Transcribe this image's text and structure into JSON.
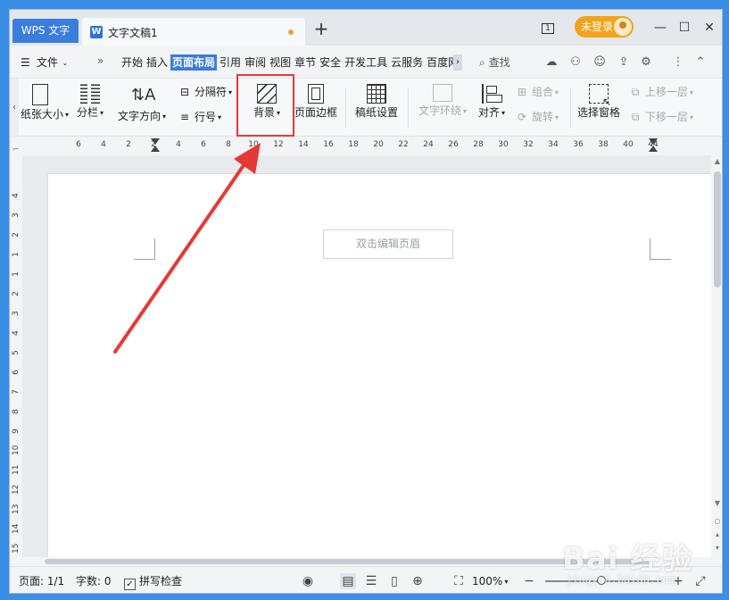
{
  "titlebar": {
    "app_tab": "WPS 文字",
    "doc_tab": "文字文稿1",
    "login": "未登录",
    "page_count_icon": "1"
  },
  "menubar": {
    "file": "文件",
    "items": [
      "开始",
      "插入",
      "页面布局",
      "引用",
      "审阅",
      "视图",
      "章节",
      "安全",
      "开发工具",
      "云服务",
      "百度网"
    ],
    "active_index": 2,
    "search": "查找"
  },
  "ribbon": {
    "paper_size": "纸张大小",
    "columns": "分栏",
    "text_direction": "文字方向",
    "separator": "分隔符",
    "line_number": "行号",
    "background": "背景",
    "page_border": "页面边框",
    "manuscript": "稿纸设置",
    "text_wrap": "文字环绕",
    "align": "对齐",
    "group": "组合",
    "rotate": "旋转",
    "selection_pane": "选择窗格",
    "bring_forward": "上移一层",
    "send_backward": "下移一层"
  },
  "ruler": {
    "h_labels": [
      "6",
      "4",
      "2",
      "2",
      "4",
      "6",
      "8",
      "10",
      "12",
      "14",
      "16",
      "18",
      "20",
      "22",
      "24",
      "26",
      "28",
      "30",
      "32",
      "34",
      "36",
      "38",
      "40",
      "44"
    ],
    "v_labels": [
      "4",
      "3",
      "2",
      "1",
      "1",
      "2",
      "3",
      "4",
      "5",
      "6",
      "7",
      "8",
      "9",
      "10",
      "11",
      "12",
      "13",
      "14",
      "15"
    ]
  },
  "document": {
    "header_hint": "双击编辑页眉"
  },
  "statusbar": {
    "page": "页面: 1/1",
    "words": "字数: 0",
    "spellcheck": "拼写检查",
    "zoom": "100%"
  },
  "watermark": {
    "brand": "Bai 经验",
    "url": "jingyan.baidu.com"
  },
  "colors": {
    "accent": "#3b7ddc",
    "login_pill": "#f2a31c",
    "highlight": "#e53935"
  }
}
